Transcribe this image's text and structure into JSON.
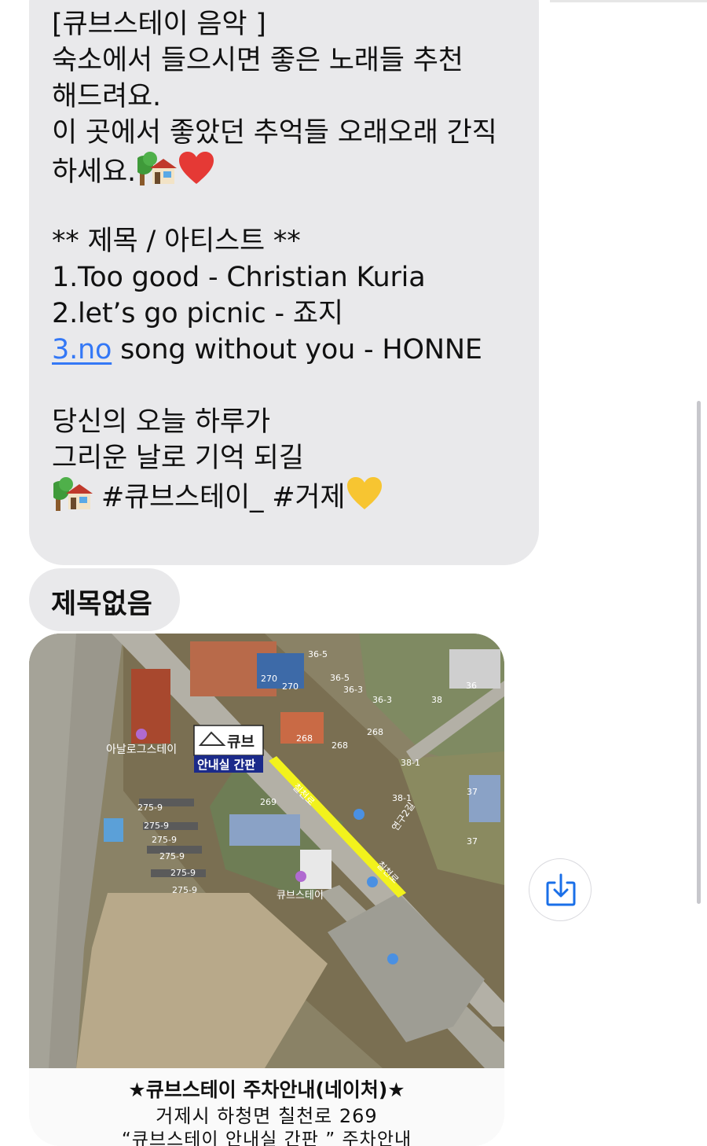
{
  "message": {
    "lines": [
      "[큐브스테이 음악 ]",
      "숙소에서 들으시면 좋은 노래들 추천",
      "해드려요.",
      "이 곳에서 좋았던 추억들 오래오래 간직",
      "하세요.",
      "",
      "** 제목 / 아티스트 **",
      "1.Too good - Christian Kuria",
      "2.let’s go picnic - 죠지",
      "3.no",
      " song without you - HONNE",
      "",
      "당신의 오늘 하루가",
      "그리운 날로 기억 되길",
      " #큐브스테이_ #거제"
    ]
  },
  "title_message": "제목없음",
  "map": {
    "sign_brand": "큐브",
    "sign_label": "안내실 간판",
    "labels": {
      "anal": "아날로그스테이",
      "cube": "큐브스테이",
      "road1": "칠천로",
      "road2": "칠천로",
      "road3": "연구2길",
      "n365": "36-5",
      "n365b": "36-5",
      "n363": "36-3",
      "n363b": "36-3",
      "n270a": "270",
      "n270b": "270",
      "n268a": "268",
      "n268b": "268",
      "n268c": "268",
      "n38": "38",
      "n381": "38-1",
      "n381b": "38-1",
      "n36": "36",
      "n37a": "37",
      "n37b": "37",
      "n269": "269",
      "n2759a": "275-9",
      "n2759b": "275-9",
      "n2759c": "275-9",
      "n2759d": "275-9",
      "n2759e": "275-9",
      "n2759f": "275-9"
    }
  },
  "caption": {
    "line1": "★큐브스테이 주차안내(네이처)★",
    "line2": "거제시 하청면 칠천로 269",
    "line3": "“큐브스테이 안내실 간판 ”  주차안내"
  },
  "icons": {
    "house": "house-with-garden-icon",
    "heart": "red-heart-icon",
    "yellow_heart": "yellow-heart-icon",
    "save": "save-download-icon"
  },
  "colors": {
    "bubble": "#e9e9eb",
    "link": "#3478f6",
    "accent": "#1a6fe8"
  }
}
